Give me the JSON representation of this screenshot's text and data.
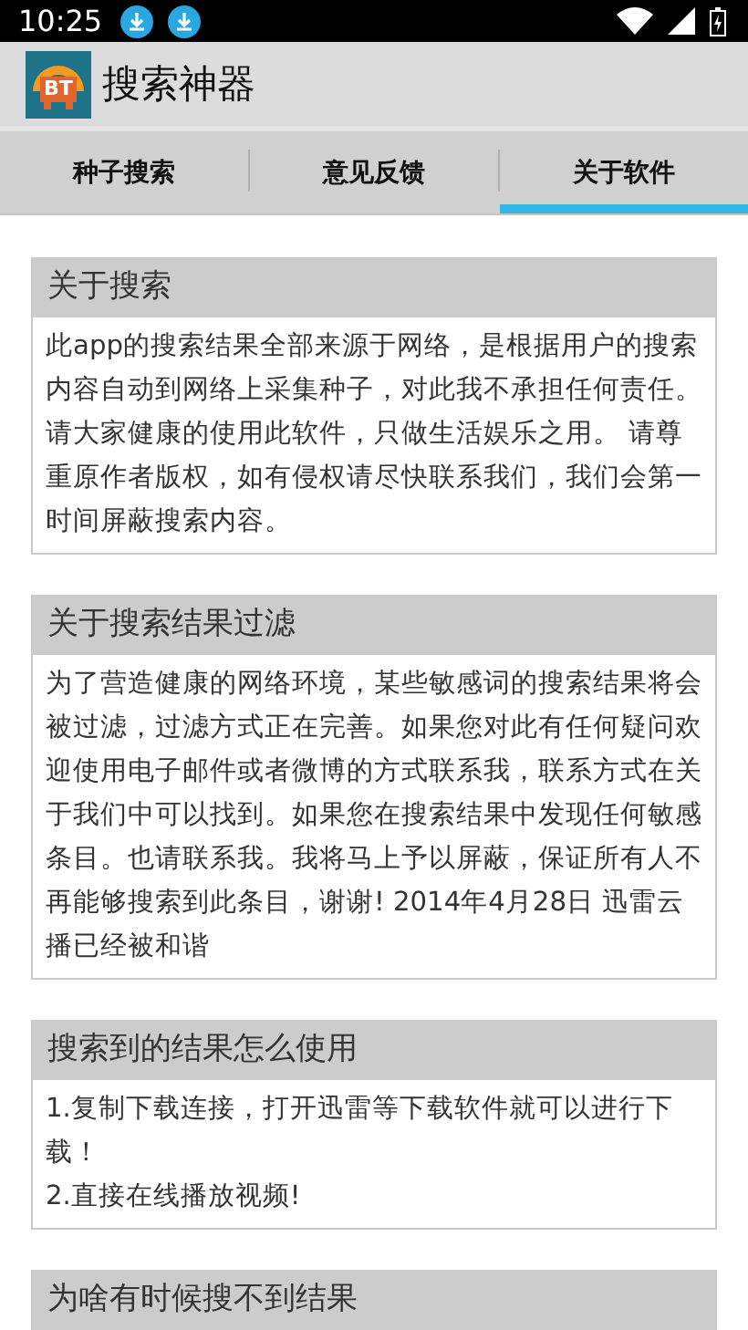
{
  "status_bar": {
    "time": "10:25"
  },
  "app_bar": {
    "logo_text": "BT",
    "title": "搜索神器"
  },
  "tabs": [
    {
      "label": "种子搜索",
      "selected": false
    },
    {
      "label": "意见反馈",
      "selected": false
    },
    {
      "label": "关于软件",
      "selected": true
    }
  ],
  "sections": [
    {
      "title": "关于搜索",
      "paragraphs": [
        "此app的搜索结果全部来源于网络，是根据用户的搜索内容自动到网络上采集种子，对此我不承担任何责任。请大家健康的使用此软件，只做生活娱乐之用。 请尊重原作者版权，如有侵权请尽快联系我们，我们会第一时间屏蔽搜索内容。"
      ]
    },
    {
      "title": "关于搜索结果过滤",
      "paragraphs": [
        "为了营造健康的网络环境，某些敏感词的搜索结果将会被过滤，过滤方式正在完善。如果您对此有任何疑问欢迎使用电子邮件或者微博的方式联系我，联系方式在关于我们中可以找到。如果您在搜索结果中发现任何敏感条目。也请联系我。我将马上予以屏蔽，保证所有人不再能够搜索到此条目，谢谢! 2014年4月28日 迅雷云播已经被和谐"
      ]
    },
    {
      "title": "搜索到的结果怎么使用",
      "paragraphs": [
        "1.复制下载连接，打开迅雷等下载软件就可以进行下载！",
        "2.直接在线播放视频!"
      ]
    },
    {
      "title": "为啥有时候搜不到结果"
    }
  ]
}
